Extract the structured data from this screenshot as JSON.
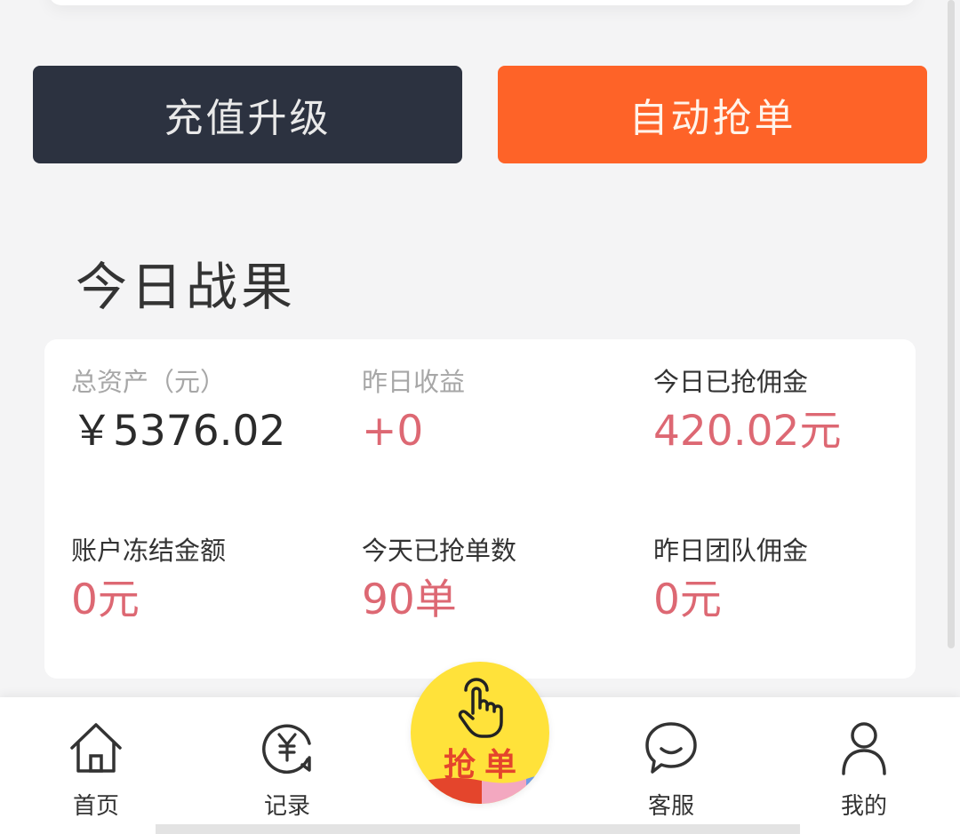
{
  "actions": {
    "recharge_label": "充值升级",
    "auto_grab_label": "自动抢单"
  },
  "section": {
    "title": "今日战果"
  },
  "stats": {
    "total_assets_label": "总资产（元）",
    "total_assets_value": "￥5376.02",
    "yesterday_income_label": "昨日收益",
    "yesterday_income_value": "+0",
    "today_commission_label": "今日已抢佣金",
    "today_commission_value": "420.02元",
    "frozen_label": "账户冻结金额",
    "frozen_value": "0元",
    "today_orders_label": "今天已抢单数",
    "today_orders_value": "90单",
    "team_commission_label": "昨日团队佣金",
    "team_commission_value": "0元"
  },
  "tabbar": {
    "home": "首页",
    "records": "记录",
    "grab": "抢单",
    "service": "客服",
    "mine": "我的"
  },
  "colors": {
    "dark_button": "#2c3240",
    "accent_orange": "#fe6328",
    "value_pink": "#dd6873",
    "grab_yellow": "#ffe23a"
  },
  "icons": {
    "home": "house-icon",
    "records": "yuan-record-icon",
    "grab": "tap-hand-icon",
    "service": "chat-bubble-icon",
    "mine": "user-icon"
  }
}
